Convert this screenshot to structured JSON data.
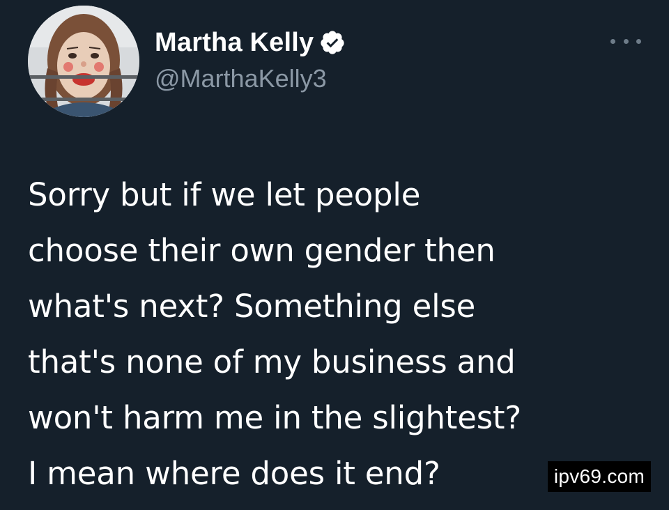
{
  "author": {
    "display_name": "Martha Kelly",
    "handle": "@MarthaKelly3",
    "verified": true,
    "avatar_description_icon": "profile-photo"
  },
  "menu": {
    "icon": "more-options-icon"
  },
  "tweet": {
    "text": "Sorry but if we let people\nchoose their own gender then\nwhat's next? Something else\nthat's none of my business and\nwon't harm me in the slightest?\nI mean where does it end?"
  },
  "watermark": {
    "text": "ipv69.com"
  },
  "colors": {
    "background": "#15202b",
    "text": "#ffffff",
    "secondary_text": "#8b98a5",
    "verified_badge": "#ffffff"
  }
}
